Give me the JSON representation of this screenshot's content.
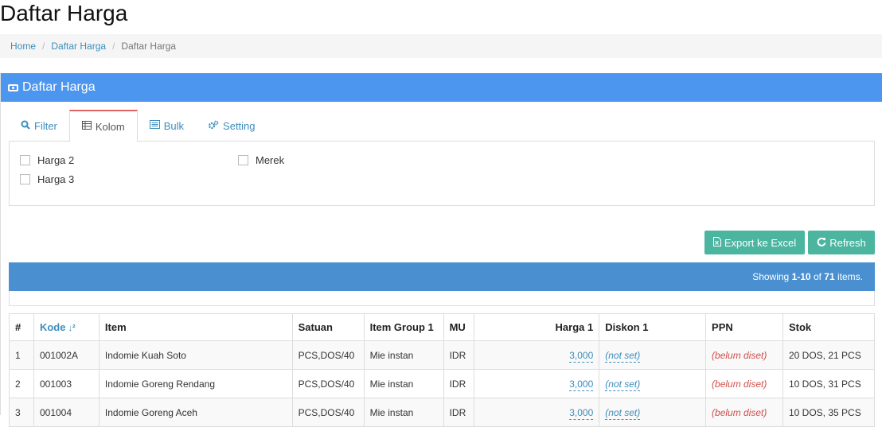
{
  "page": {
    "title": "Daftar Harga"
  },
  "breadcrumb": [
    "Home",
    "Daftar Harga",
    "Daftar Harga"
  ],
  "panel": {
    "title": "Daftar Harga"
  },
  "tabs": [
    {
      "label": "Filter",
      "icon": "search-icon"
    },
    {
      "label": "Kolom",
      "icon": "table-icon"
    },
    {
      "label": "Bulk",
      "icon": "list-icon"
    },
    {
      "label": "Setting",
      "icon": "gears-icon"
    }
  ],
  "columns_options": [
    {
      "label": "Harga 2",
      "checked": false
    },
    {
      "label": "Harga 3",
      "checked": false
    },
    {
      "label": "Merek",
      "checked": false
    }
  ],
  "buttons": {
    "export": "Export ke Excel",
    "refresh": "Refresh"
  },
  "summary": {
    "prefix": "Showing ",
    "range": "1-10",
    "of": " of ",
    "total": "71",
    "suffix": " items."
  },
  "table": {
    "headers": [
      "#",
      "Kode",
      "Item",
      "Satuan",
      "Item Group 1",
      "MU",
      "Harga 1",
      "Diskon 1",
      "PPN",
      "Stok"
    ],
    "rows": [
      [
        "1",
        "001002A",
        "Indomie Kuah Soto",
        "PCS,DOS/40",
        "Mie instan",
        "IDR",
        "3,000",
        "(not set)",
        "(belum diset)",
        "20 DOS, 21 PCS"
      ],
      [
        "2",
        "001003",
        "Indomie Goreng Rendang",
        "PCS,DOS/40",
        "Mie instan",
        "IDR",
        "3,000",
        "(not set)",
        "(belum diset)",
        "10 DOS, 31 PCS"
      ],
      [
        "3",
        "001004",
        "Indomie Goreng Aceh",
        "PCS,DOS/40",
        "Mie instan",
        "IDR",
        "3,000",
        "(not set)",
        "(belum diset)",
        "10 DOS, 35 PCS"
      ]
    ]
  }
}
